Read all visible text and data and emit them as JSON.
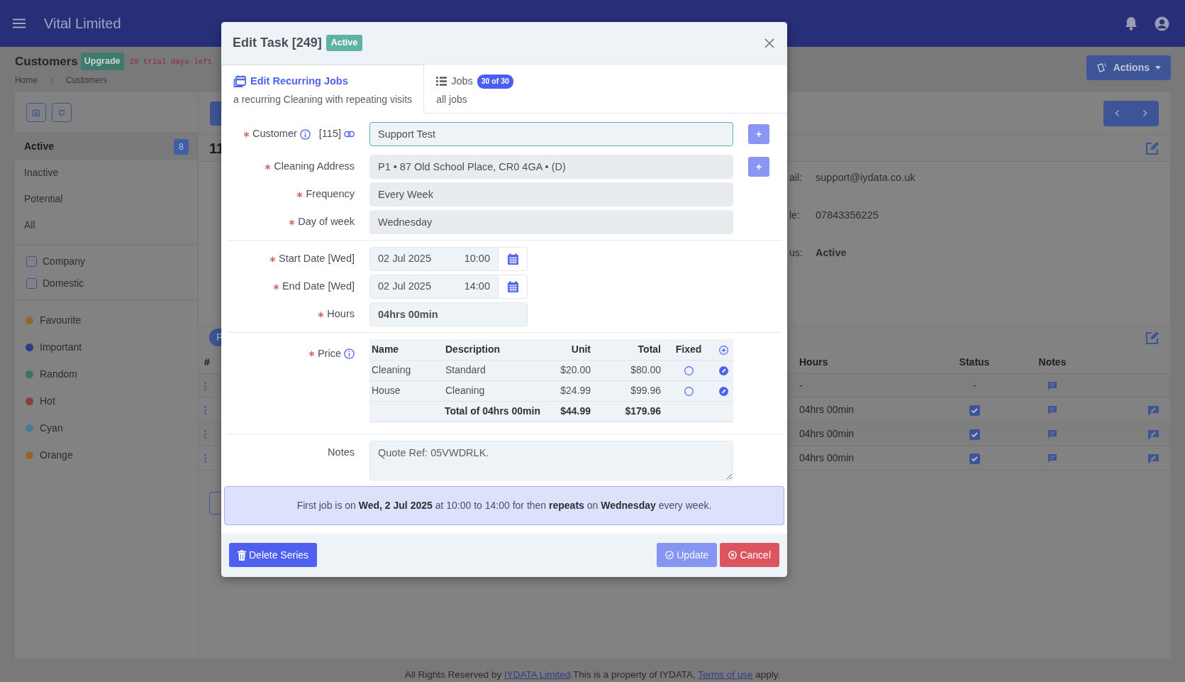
{
  "navbar": {
    "title": "Vital Limited"
  },
  "page_header": {
    "title": "Customers",
    "badge": "Upgrade",
    "trial_note": "29 trial days left",
    "actions_button": "Actions"
  },
  "breadcrumb": [
    "Home",
    "Customers"
  ],
  "sidebar": {
    "status_items": [
      {
        "label": "Active",
        "count": "8",
        "selected": true
      },
      {
        "label": "Inactive",
        "selected": false
      },
      {
        "label": "Potential",
        "selected": false
      },
      {
        "label": "All",
        "selected": false
      }
    ],
    "type_filters": [
      {
        "label": "Company",
        "checked": false
      },
      {
        "label": "Domestic",
        "checked": false
      }
    ],
    "tags": [
      {
        "label": "Favourite",
        "color": "#8f6a2e"
      },
      {
        "label": "Important",
        "color": "#2f3a8f"
      },
      {
        "label": "Random",
        "color": "#3a7468"
      },
      {
        "label": "Hot",
        "color": "#8f3a3f"
      },
      {
        "label": "Cyan",
        "color": "#4f7a96"
      },
      {
        "label": "Orange",
        "color": "#99622a"
      }
    ]
  },
  "customer_panel": {
    "heading": "11",
    "details": [
      {
        "label": "ail:",
        "value": "support@iydata.co.uk",
        "bold": false
      },
      {
        "label": "le:",
        "value": "07843356225",
        "bold": false
      },
      {
        "label": "us:",
        "value": "Active",
        "bold": true
      }
    ]
  },
  "jobs_panel": {
    "pill": "P",
    "columns": [
      "#",
      "Hours",
      "Status",
      "Notes"
    ],
    "rows": [
      {
        "kind": "placeholder",
        "hours": "-",
        "status": "-"
      },
      {
        "kind": "job",
        "hours": "04hrs 00min",
        "checked": true
      },
      {
        "kind": "job",
        "hours": "04hrs 00min",
        "checked": true
      },
      {
        "kind": "job",
        "hours": "04hrs 00min",
        "checked": true
      }
    ]
  },
  "modal": {
    "title": "Edit Task [249]",
    "status_badge": "Active",
    "tabs": [
      {
        "title": "Edit Recurring Jobs",
        "subtitle": "a recurring Cleaning with repeating visits",
        "selected": true
      },
      {
        "title": "Jobs",
        "badge": "30 of 30",
        "subtitle": "all jobs",
        "selected": false
      }
    ],
    "fields": [
      {
        "kind": "customer",
        "label": "Customer",
        "id": "[115]",
        "value": "Support Test",
        "required": true,
        "disabled": false,
        "add_button": "+"
      },
      {
        "kind": "select",
        "label": "Cleaning Address",
        "value": "P1 • 87 Old School Place, CR0 4GA • (D)",
        "required": true,
        "disabled": true,
        "add_button": "+"
      },
      {
        "kind": "select",
        "label": "Frequency",
        "value": "Every Week",
        "required": true,
        "disabled": true
      },
      {
        "kind": "select",
        "label": "Day of week",
        "value": "Wednesday",
        "required": true,
        "disabled": true
      }
    ],
    "dates": [
      {
        "label": "Start Date [Wed]",
        "date": "02 Jul 2025",
        "time": "10:00",
        "required": true
      },
      {
        "label": "End Date [Wed]",
        "date": "02 Jul 2025",
        "time": "14:00",
        "required": true
      }
    ],
    "hours": {
      "label": "Hours",
      "value": "04hrs 00min",
      "required": true
    },
    "price": {
      "label": "Price",
      "required": true,
      "columns": [
        "Name",
        "Description",
        "Unit",
        "Total",
        "Fixed"
      ],
      "rows": [
        {
          "name": "Cleaning",
          "description": "Standard",
          "unit": "$20.00",
          "total": "$80.00",
          "fixed": false
        },
        {
          "name": "House",
          "description": "Cleaning",
          "unit": "$24.99",
          "total": "$99.96",
          "fixed": false
        }
      ],
      "total": {
        "label": "Total of 04hrs 00min",
        "unit": "$44.99",
        "total": "$179.96"
      }
    },
    "notes": {
      "label": "Notes",
      "value": "Quote Ref: 05VWDRLK."
    },
    "summary": "First job is on **Wed, 2 Jul 2025** at 10:00 to 14:00 for then **repeats** on **Wednesday** every week.",
    "buttons": {
      "delete": "Delete Series",
      "update": {
        "label": "Update",
        "disabled": true
      },
      "cancel": "Cancel"
    }
  },
  "footer": [
    {
      "kind": "text",
      "text": "All Rights Reserved by "
    },
    {
      "kind": "link",
      "text": "IYDATA Limited"
    },
    {
      "kind": "text",
      "text": ".This is a property of IYDATA, "
    },
    {
      "kind": "link",
      "text": "Terms of use"
    },
    {
      "kind": "text",
      "text": " apply."
    }
  ]
}
